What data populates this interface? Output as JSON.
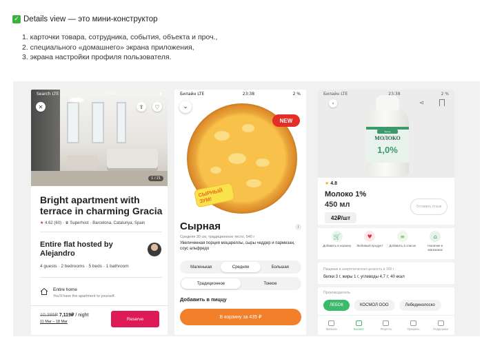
{
  "intro": {
    "check_mark": "✓",
    "title": "Details view — это мини-конструктор",
    "items": [
      "1. карточки товара, сотрудника, события, объекта и проч.,",
      "2. специального «домашнего» экрана приложения,",
      "3. экрана настройки профиля пользователя."
    ]
  },
  "airbnb": {
    "status": {
      "carrier": "Search LTE",
      "time": "23:47"
    },
    "photo_counter": "1 / 21",
    "title": "Bright apartment with terrace in charming Gracia",
    "rating": "4.62 (60)",
    "superhost": "Superhost",
    "location": "Barcelona, Catalunya, Spain",
    "host_title": "Entire flat hosted by Alejandro",
    "rooms": "4 guests · 2 bedrooms · 5 beds · 1 bathroom",
    "feature_title": "Entire home",
    "feature_sub": "You'll have the apartment to yourself.",
    "old_price": "10,386₽",
    "price": "7,119₽",
    "per": " / night",
    "dates": "11 Mar – 18 Mar",
    "reserve_label": "Reserve"
  },
  "pizza": {
    "status": {
      "carrier": "Билайн LTE",
      "time": "23:38",
      "battery": "2 %"
    },
    "badge": "NEW",
    "sticker": "СЫРНЫЙ ЗУМ!",
    "name": "Сырная",
    "spec": "Средняя 30 см, традиционное тесто, 540 г",
    "description": "Увеличенная порция моцареллы, сыры чеддер и пармезан, соус альфредо",
    "sizes": [
      "Маленькая",
      "Средняя",
      "Большая"
    ],
    "selected_size": "Средняя",
    "doughs": [
      "Традиционное",
      "Тонкое"
    ],
    "selected_dough": "Традиционное",
    "add_label": "Добавить в пиццу",
    "cart_label": "В корзину за 435 ₽"
  },
  "milk": {
    "status": {
      "carrier": "Билайн LTE",
      "time": "23:38",
      "battery": "2 %"
    },
    "bottle_brand": "Бренд",
    "bottle_name": "МОЛОКО",
    "bottle_fat": "1,0%",
    "rating": "4.8",
    "name": "Молоко 1%",
    "volume": "450 мл",
    "price": "42₽/шт",
    "review_label": "Оставить отзыв",
    "actions": [
      {
        "icon": "cart-icon",
        "glyph": "🛒",
        "label": "Добавить в корзину",
        "bg": "#e4f6ea",
        "color": "#3bba6c"
      },
      {
        "icon": "heart-icon",
        "glyph": "♥",
        "label": "Любимый продукт",
        "bg": "#fde7ea",
        "color": "#e0314b"
      },
      {
        "icon": "list-add-icon",
        "glyph": "≡",
        "label": "Добавить в список",
        "bg": "#eef7ea",
        "color": "#6bb14a"
      },
      {
        "icon": "store-icon",
        "glyph": "⌂",
        "label": "Наличие в магазинах",
        "bg": "#e6f3ec",
        "color": "#3a9a6a"
      }
    ],
    "nutrition_header": "Пищевая и энергетическая ценность в 100 г",
    "nutrition": "белки 3 г, жиры 1 г, углеводы 4,7 г; 40 ккал",
    "maker_header": "Производитель",
    "makers": [
      "ЛЕБОК",
      "КОСМОЛ ООО",
      "Лебединолоско"
    ],
    "selected_maker": "ЛЕБОК",
    "tabs": [
      "Магазин",
      "Каталог",
      "Рецепты",
      "Профиль",
      "Поддержка"
    ],
    "active_tab": "Каталог"
  },
  "colors": {
    "airbnb_accent": "#de1b57",
    "pizza_accent": "#f2802a",
    "milk_accent": "#3bba6c"
  }
}
